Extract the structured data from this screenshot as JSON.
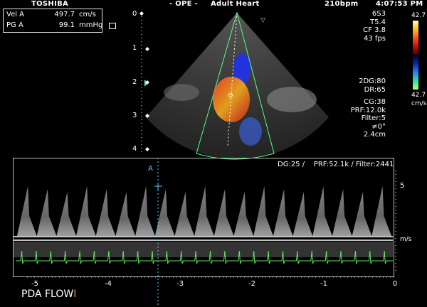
{
  "header": {
    "brand": "TOSHIBA",
    "mode": "- OPE -",
    "preset": "Adult Heart",
    "heart_rate": "210bpm",
    "time": "4:07:53 PM"
  },
  "measurements": [
    {
      "label": "Vel A",
      "value": "497.7",
      "unit": "cm/s"
    },
    {
      "label": "PG A",
      "value": "99.1",
      "unit": "mmHg"
    }
  ],
  "probe_params": [
    "6S3",
    "T5.4",
    "CF 3.8",
    "43 fps"
  ],
  "color_scale": {
    "top": "42.7",
    "bottom": "42.7",
    "unit": "cm/s"
  },
  "doppler_params": [
    "2DG:80",
    "DR:65",
    "",
    "CG:38",
    "PRF:12.0k",
    "Filter:5",
    "≠0°",
    "2.4cm"
  ],
  "depth_labels": [
    "0",
    "1",
    "2",
    "3",
    "4"
  ],
  "sector_marker": "▽",
  "spectral": {
    "params": "DG:25 /    PRF:52.1k / Filter:2441",
    "cursor_label": "A",
    "scale_top": "5",
    "unit": "m/s",
    "time_labels": [
      "-5",
      "-4",
      "-3",
      "-2",
      "-1",
      "0"
    ]
  },
  "caption": "PDA FLOW",
  "colors": {
    "ecg": "#5ee85e",
    "sector_outline": "#55ff88",
    "cursor": "#4fd0ff"
  }
}
